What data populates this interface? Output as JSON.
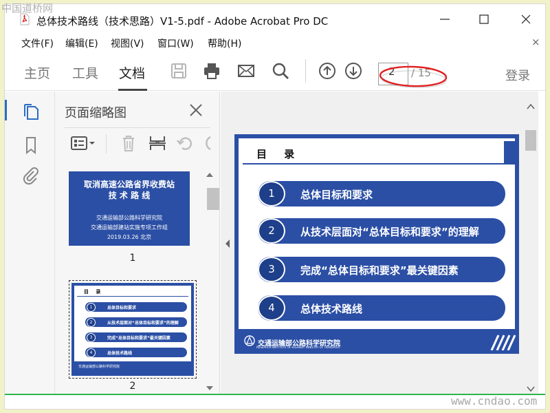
{
  "titlebar": {
    "title": "总体技术路线（技术思路）V1-5.pdf - Adobe Acrobat Pro DC"
  },
  "menu": {
    "items": [
      "文件(F)",
      "编辑(E)",
      "视图(V)",
      "窗口(W)",
      "帮助(H)"
    ],
    "close": "×"
  },
  "toolbar": {
    "tabs": [
      "主页",
      "工具",
      "文档"
    ],
    "active_tab": "文档",
    "page_current": "2",
    "page_total": "/ 15",
    "signin": "登录"
  },
  "thumbnails": {
    "title": "页面缩略图",
    "thumb1": {
      "title_line1": "取消高速公路省界收费站",
      "title_line2": "技 术 路 线",
      "org1": "交通运输部公路科学研究院",
      "org2": "交通运输部建站实施专项工作组",
      "date": "2019.03.26 北京"
    },
    "thumb1_label": "1",
    "thumb2": {
      "header": "目 录",
      "items": [
        "总体目标和要求",
        "从技术层面对“总体目标和要求”的理解",
        "完成“总体目标和要求”最关键因素",
        "总体技术路线"
      ],
      "footer": "交通运输部公路科学研究院"
    },
    "thumb2_label": "2"
  },
  "document": {
    "header": "目 录",
    "items": [
      {
        "num": "1",
        "text": "总体目标和要求"
      },
      {
        "num": "2",
        "text": "从技术层面对“总体目标和要求”的理解"
      },
      {
        "num": "3",
        "text": "完成“总体目标和要求”最关键因素"
      },
      {
        "num": "4",
        "text": "总体技术路线"
      }
    ],
    "footer": "交通运输部公路科学研究院",
    "footer_sub": "RESEARCH INSTITUTE OF HIGHWAY MINISTRY OF TRANSPORT"
  },
  "watermarks": {
    "top": "中国道桥网",
    "bottom": "www.cndao.com"
  },
  "colors": {
    "slide_blue": "#2b4fa5",
    "annotation_red": "#e02020",
    "accent_blue": "#2a6cc4"
  }
}
